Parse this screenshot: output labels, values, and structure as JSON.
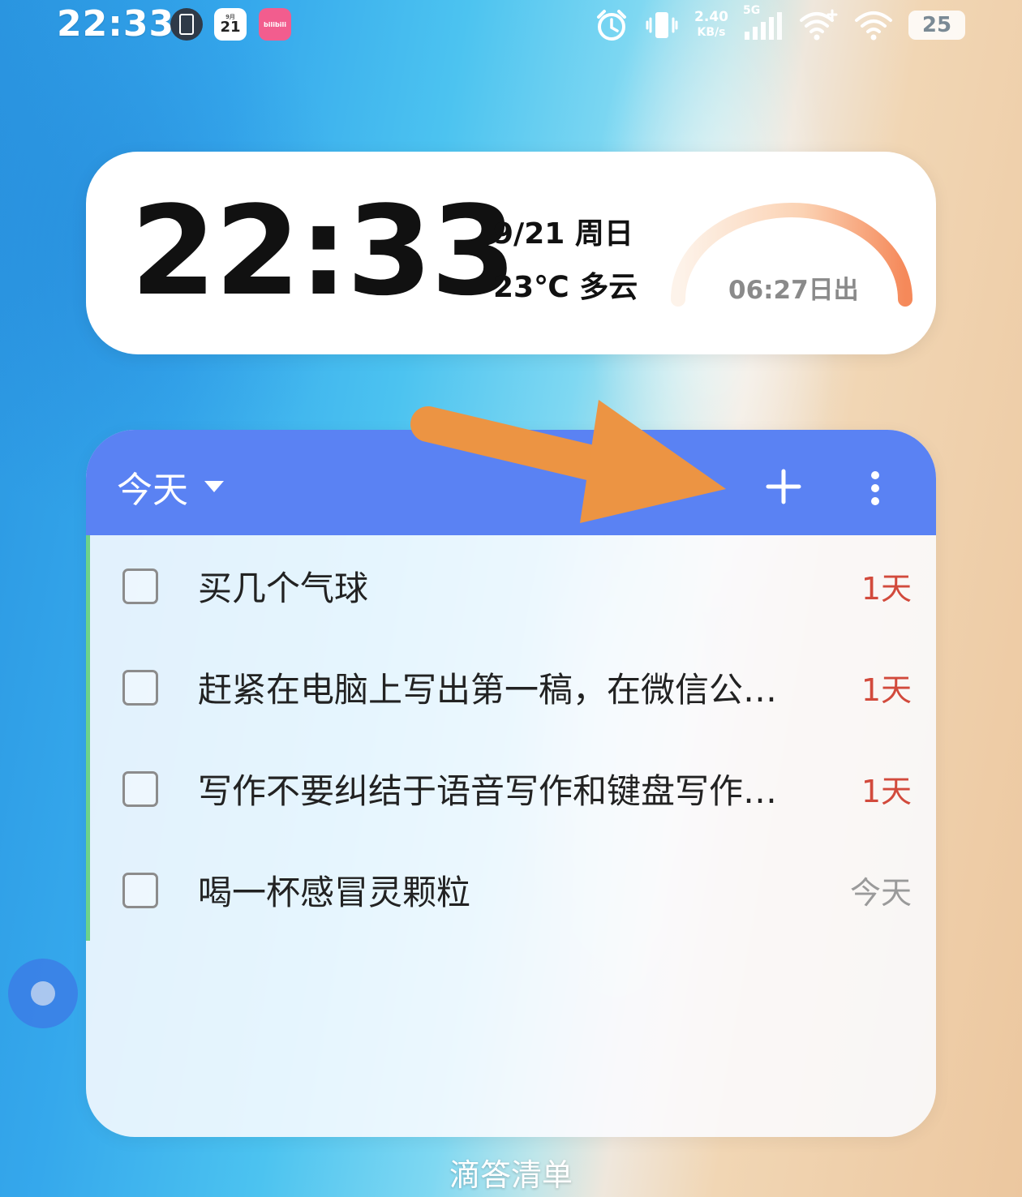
{
  "status_bar": {
    "time": "22:33",
    "apps": {
      "calendar_month": "9月",
      "calendar_day": "21",
      "bili_label": "bilibili"
    },
    "net_speed_value": "2.40",
    "net_speed_unit": "KB/s",
    "network_type": "5G",
    "battery": "25"
  },
  "clock_widget": {
    "time": "22:33",
    "date": "9/21 周日",
    "weather": "23℃ 多云",
    "sunrise": "06:27日出"
  },
  "todo_widget": {
    "list_name": "今天",
    "tasks": [
      {
        "title": "买几个气球",
        "due": "1天"
      },
      {
        "title": "赶紧在电脑上写出第一稿，在微信公…",
        "due": "1天"
      },
      {
        "title": "写作不要纠结于语音写作和键盘写作…",
        "due": "1天"
      },
      {
        "title": "喝一杯感冒灵颗粒",
        "due": "今天"
      }
    ],
    "colors": {
      "header": "#5a82f3",
      "due_overdue": "#d24a3c",
      "due_today": "#9a9a9a",
      "accent": "#6dd28a"
    }
  },
  "annotation": {
    "arrow_color": "#ec9443"
  },
  "widget_label": "滴答清单"
}
